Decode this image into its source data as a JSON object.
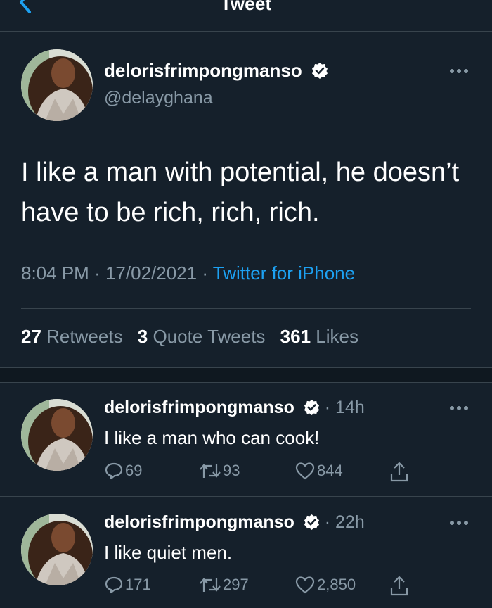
{
  "header": {
    "title": "Tweet"
  },
  "main_tweet": {
    "display_name": "delorisfrimpongmanso",
    "handle": "@delayghana",
    "text": "I like a man with potential, he doesn’t have to be rich, rich, rich.",
    "time": "8:04 PM",
    "date": "17/02/2021",
    "source": "Twitter for iPhone",
    "separator": "·",
    "stats": {
      "retweets_count": "27",
      "retweets_label": "Retweets",
      "quotes_count": "3",
      "quotes_label": "Quote Tweets",
      "likes_count": "361",
      "likes_label": "Likes"
    }
  },
  "replies": [
    {
      "display_name": "delorisfrimpongmanso",
      "time": "· 14h",
      "text": "I like a man who can cook!",
      "reply_count": "69",
      "retweet_count": "93",
      "like_count": "844"
    },
    {
      "display_name": "delorisfrimpongmanso",
      "time": "· 22h",
      "text": "I like quiet men.",
      "reply_count": "171",
      "retweet_count": "297",
      "like_count": "2,850"
    }
  ],
  "colors": {
    "background": "#15202b",
    "accent": "#1da1f2",
    "secondary_text": "#8899a6",
    "divider": "#38444d"
  },
  "icons": [
    "back-icon",
    "verified-icon",
    "more-icon",
    "reply-icon",
    "retweet-icon",
    "like-icon",
    "share-icon"
  ]
}
